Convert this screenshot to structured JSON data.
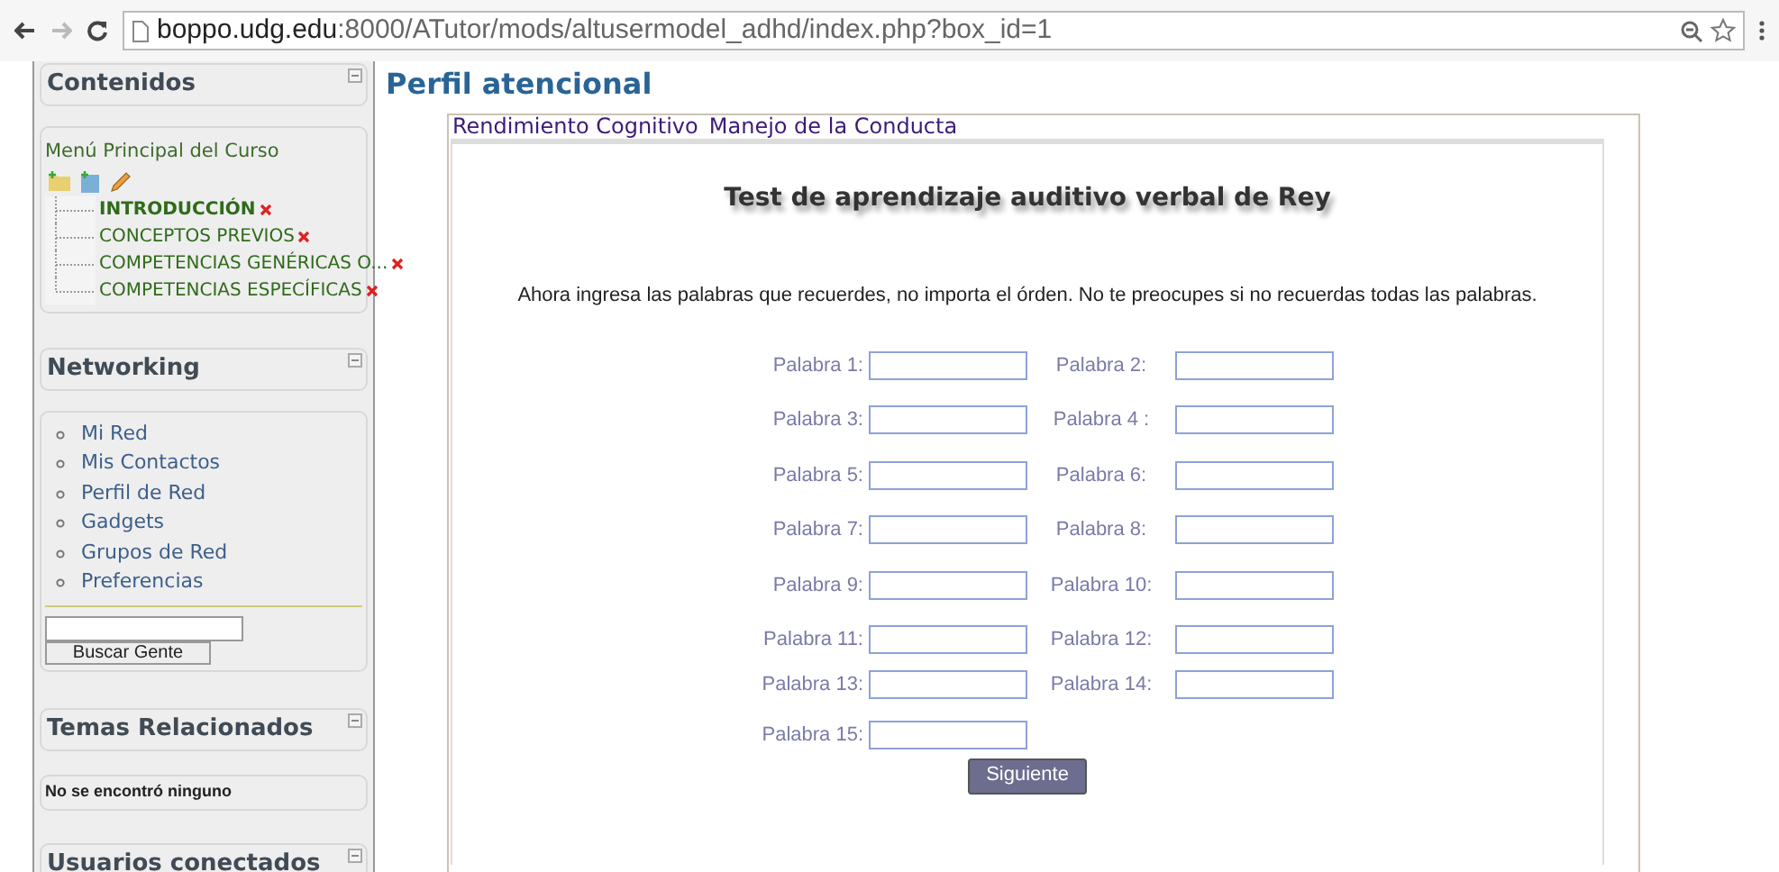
{
  "browser": {
    "url_host": "boppo.udg.edu",
    "url_path": ":8000/ATutor/mods/altusermodel_adhd/index.php?box_id=1"
  },
  "sidebar": {
    "contenidos": {
      "title": "Contenidos",
      "menu_title": "Menú Principal del Curso",
      "items": [
        {
          "label": "INTRODUCCIÓN",
          "selected": true
        },
        {
          "label": "CONCEPTOS PREVIOS",
          "selected": false
        },
        {
          "label": "COMPETENCIAS GENÉRICAS O...",
          "selected": false
        },
        {
          "label": "COMPETENCIAS ESPECÍFICAS",
          "selected": false
        }
      ]
    },
    "networking": {
      "title": "Networking",
      "links": [
        "Mi Red",
        "Mis Contactos",
        "Perfil de Red",
        "Gadgets",
        "Grupos de Red",
        "Preferencias"
      ],
      "search_button": "Buscar Gente"
    },
    "temas": {
      "title": "Temas Relacionados",
      "text": "No se encontró ninguno"
    },
    "usuarios": {
      "title": "Usuarios conectados"
    }
  },
  "page_title": "Perfil atencional",
  "panel": {
    "tabs": [
      {
        "label": "Rendimiento Cognitivo",
        "selected": false
      },
      {
        "label": "Manejo de la Conducta",
        "selected": false
      }
    ],
    "heading": "Test de aprendizaje auditivo verbal de Rey",
    "instructions": "Ahora ingresa las palabras que recuerdes, no importa el órden. No te preocupes si no recuerdas todas las palabras.",
    "fields": [
      "Palabra 1:",
      "Palabra 2:",
      "Palabra 3:",
      "Palabra 4 :",
      "Palabra 5:",
      "Palabra 6:",
      "Palabra 7:",
      "Palabra 8:",
      "Palabra 9:",
      "Palabra 10:",
      "Palabra 11:",
      "Palabra 12:",
      "Palabra 13:",
      "Palabra 14:",
      "Palabra 15:"
    ],
    "submit": "Siguiente"
  }
}
